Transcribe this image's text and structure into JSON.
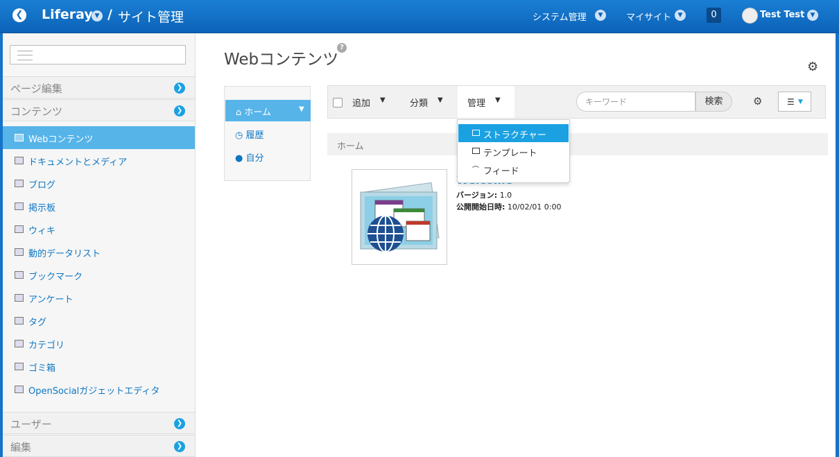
{
  "header": {
    "brand": "Liferay",
    "separator": "/",
    "site_title": "サイト管理",
    "nav": [
      "システム管理",
      "マイサイト"
    ],
    "notification_count": "0",
    "user_name": "Test Test"
  },
  "sidebar": {
    "sections": {
      "page_edit": "ページ編集",
      "content": "コンテンツ",
      "users": "ユーザー",
      "edit": "編集"
    },
    "items": [
      {
        "label": "Webコンテンツ",
        "icon": "web-content-icon",
        "active": true
      },
      {
        "label": "ドキュメントとメディア",
        "icon": "documents-icon"
      },
      {
        "label": "ブログ",
        "icon": "blog-icon"
      },
      {
        "label": "掲示板",
        "icon": "message-board-icon"
      },
      {
        "label": "ウィキ",
        "icon": "wiki-icon"
      },
      {
        "label": "動的データリスト",
        "icon": "dynamic-data-icon"
      },
      {
        "label": "ブックマーク",
        "icon": "bookmark-icon"
      },
      {
        "label": "アンケート",
        "icon": "poll-icon"
      },
      {
        "label": "タグ",
        "icon": "tag-icon"
      },
      {
        "label": "カテゴリ",
        "icon": "category-icon"
      },
      {
        "label": "ゴミ箱",
        "icon": "trash-icon"
      },
      {
        "label": "OpenSocialガジェットエディタ",
        "icon": "gadget-icon"
      }
    ]
  },
  "main": {
    "title": "Webコンテンツ",
    "left_nav": {
      "home": "ホーム",
      "history": "履歴",
      "mine": "自分"
    },
    "toolbar": {
      "add": "追加",
      "categorize": "分類",
      "manage": "管理",
      "search_placeholder": "キーワード",
      "search_button": "検索"
    },
    "manage_menu": [
      "ストラクチャー",
      "テンプレート",
      "フィード"
    ],
    "breadcrumb": "ホーム",
    "article": {
      "name": "Welcome",
      "version_label": "バージョン:",
      "version": "1.0",
      "display_date_label": "公開開始日時:",
      "display_date": "10/02/01 0:00"
    }
  },
  "colors": {
    "header": "#1573c9",
    "active": "#56b4e9",
    "accent": "#1ba1e2",
    "link": "#0d76c2"
  }
}
